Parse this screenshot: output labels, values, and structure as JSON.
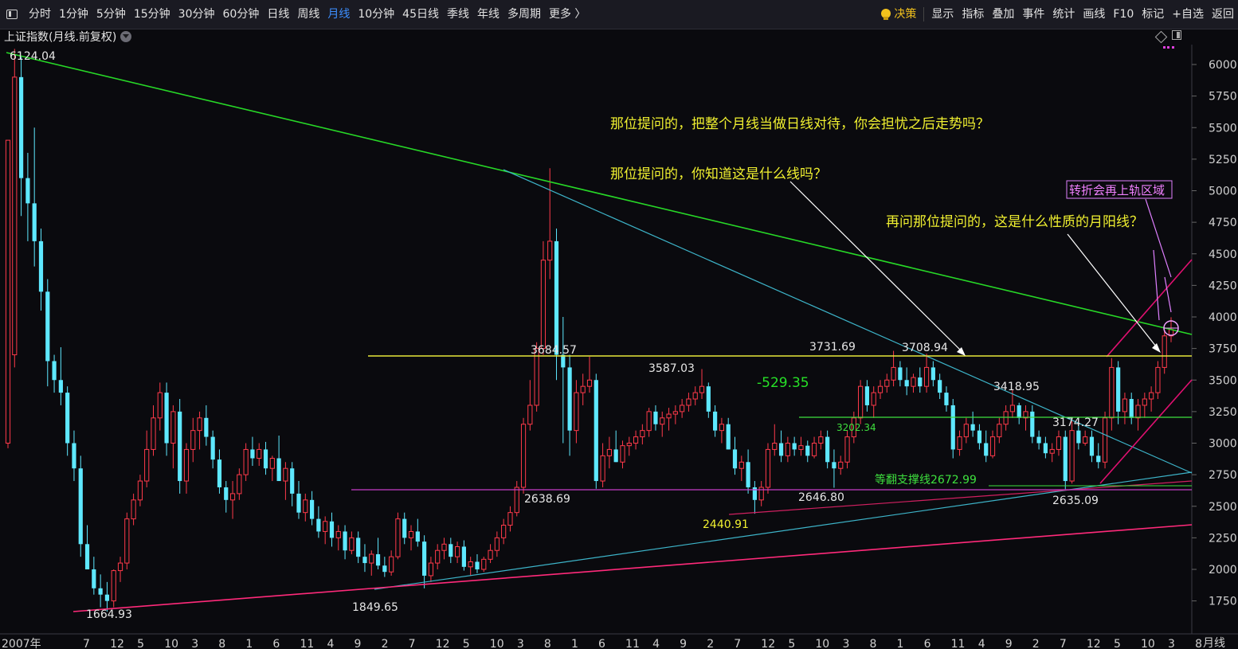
{
  "toolbar": {
    "periods": [
      "分时",
      "1分钟",
      "5分钟",
      "15分钟",
      "30分钟",
      "60分钟",
      "日线",
      "周线",
      "月线",
      "10分钟",
      "45日线",
      "季线",
      "年线",
      "多周期",
      "更多 〉"
    ],
    "active_period": "月线",
    "right_items": [
      "显示",
      "指标",
      "叠加",
      "事件",
      "统计",
      "画线",
      "F10",
      "标记",
      "+自选",
      "返回"
    ],
    "decision": "决策"
  },
  "instrument_title": "上证指数(月线.前复权)",
  "period_label": "月线",
  "colors": {
    "up": "#ff3a4a",
    "down": "#5ee8ff",
    "background": "#0a0a0e",
    "accent": "#3d8fff"
  },
  "chart_data": {
    "type": "candlestick",
    "y_ticks": [
      "6000",
      "5750",
      "5500",
      "5250",
      "5000",
      "4750",
      "4500",
      "4250",
      "4000",
      "3750",
      "3500",
      "3250",
      "3000",
      "2750",
      "2500",
      "2250",
      "2000",
      "1750"
    ],
    "x_ticks": [
      "2007年",
      "7",
      "12",
      "5",
      "10",
      "3",
      "8",
      "1",
      "6",
      "11",
      "4",
      "9",
      "2",
      "7",
      "12",
      "5",
      "10",
      "3",
      "8",
      "1",
      "6",
      "11",
      "4",
      "9",
      "2",
      "7",
      "12",
      "5",
      "10",
      "3",
      "8",
      "1",
      "6",
      "11",
      "4",
      "9",
      "2",
      "7",
      "12",
      "5",
      "10",
      "3",
      "8"
    ],
    "price_labels": [
      "6124.04",
      "1664.93",
      "1849.65",
      "3684.57",
      "2638.69",
      "3587.03",
      "2440.91",
      "2646.80",
      "3731.69",
      "3708.94",
      "3418.95",
      "3174.27",
      "2635.09",
      "3202.34"
    ],
    "annotations": {
      "q1": "那位提问的，把整个月线当做日线对待，你会担忧之后走势吗？",
      "q2": "那位提问的，你知道这是什么线吗？",
      "q3": "再问那位提问的，这是什么性质的月阳线？",
      "zone": "转折会再上轨区域",
      "diff": "-529.35",
      "support": "等翻支撑线2672.99"
    },
    "candles": [
      [
        3000,
        3700,
        2960,
        5400
      ],
      [
        3700,
        6124,
        3600,
        5900
      ],
      [
        5900,
        6060,
        4800,
        5100
      ],
      [
        5100,
        5300,
        4600,
        4900
      ],
      [
        4900,
        5500,
        4400,
        4600
      ],
      [
        4600,
        4700,
        4050,
        4200
      ],
      [
        4200,
        4300,
        3450,
        3650
      ],
      [
        3650,
        3700,
        3400,
        3500
      ],
      [
        3500,
        3760,
        3300,
        3400
      ],
      [
        3400,
        3450,
        2900,
        3000
      ],
      [
        3000,
        3100,
        2700,
        2800
      ],
      [
        2800,
        2900,
        2100,
        2200
      ],
      [
        2200,
        2350,
        2000,
        2000
      ],
      [
        2000,
        2100,
        1800,
        1850
      ],
      [
        1850,
        1960,
        1700,
        1800
      ],
      [
        1800,
        1900,
        1664.93,
        1750
      ],
      [
        1750,
        2000,
        1700,
        1990
      ],
      [
        1990,
        2100,
        1900,
        2050
      ],
      [
        2050,
        2450,
        2000,
        2400
      ],
      [
        2400,
        2600,
        2350,
        2550
      ],
      [
        2550,
        2750,
        2500,
        2700
      ],
      [
        2700,
        3100,
        2650,
        2950
      ],
      [
        2950,
        3300,
        2900,
        3200
      ],
      [
        3200,
        3480,
        3100,
        3400
      ],
      [
        3400,
        3480,
        2900,
        3000
      ],
      [
        3000,
        3300,
        2800,
        3250
      ],
      [
        3250,
        3350,
        2600,
        2700
      ],
      [
        2700,
        3000,
        2600,
        2950
      ],
      [
        2950,
        3200,
        2850,
        3100
      ],
      [
        3100,
        3250,
        2950,
        3200
      ],
      [
        3200,
        3300,
        2980,
        3050
      ],
      [
        3050,
        3100,
        2800,
        2870
      ],
      [
        2870,
        2950,
        2600,
        2650
      ],
      [
        2650,
        2700,
        2450,
        2550
      ],
      [
        2550,
        2700,
        2400,
        2600
      ],
      [
        2600,
        2800,
        2550,
        2750
      ],
      [
        2750,
        3000,
        2700,
        2950
      ],
      [
        2950,
        3050,
        2820,
        2880
      ],
      [
        2880,
        3000,
        2820,
        2950
      ],
      [
        2950,
        3010,
        2750,
        2800
      ],
      [
        2800,
        2900,
        2700,
        2880
      ],
      [
        2880,
        3060,
        2800,
        2700
      ],
      [
        2700,
        2850,
        2550,
        2800
      ],
      [
        2800,
        2850,
        2500,
        2600
      ],
      [
        2600,
        2700,
        2400,
        2450
      ],
      [
        2450,
        2600,
        2380,
        2550
      ],
      [
        2550,
        2620,
        2350,
        2400
      ],
      [
        2400,
        2500,
        2250,
        2300
      ],
      [
        2300,
        2420,
        2200,
        2380
      ],
      [
        2380,
        2450,
        2180,
        2250
      ],
      [
        2250,
        2350,
        2150,
        2300
      ],
      [
        2300,
        2350,
        2080,
        2150
      ],
      [
        2150,
        2300,
        2120,
        2250
      ],
      [
        2250,
        2300,
        2050,
        2100
      ],
      [
        2100,
        2200,
        1980,
        2050
      ],
      [
        2050,
        2150,
        1950,
        2120
      ],
      [
        2120,
        2250,
        2000,
        2030
      ],
      [
        2030,
        2100,
        1940,
        1980
      ],
      [
        1980,
        2150,
        1950,
        2100
      ],
      [
        2100,
        2450,
        2080,
        2400
      ],
      [
        2400,
        2450,
        2200,
        2250
      ],
      [
        2250,
        2350,
        2150,
        2300
      ],
      [
        2300,
        2400,
        2180,
        2220
      ],
      [
        2220,
        2270,
        1849.65,
        1950
      ],
      [
        1950,
        2100,
        1900,
        2050
      ],
      [
        2050,
        2200,
        2000,
        2150
      ],
      [
        2150,
        2250,
        2080,
        2200
      ],
      [
        2200,
        2250,
        2050,
        2100
      ],
      [
        2100,
        2220,
        2050,
        2180
      ],
      [
        2180,
        2230,
        1990,
        2020
      ],
      [
        2020,
        2100,
        1950,
        2060
      ],
      [
        2060,
        2120,
        1970,
        2000
      ],
      [
        2000,
        2100,
        1980,
        2080
      ],
      [
        2080,
        2200,
        2050,
        2150
      ],
      [
        2150,
        2300,
        2100,
        2250
      ],
      [
        2250,
        2400,
        2200,
        2350
      ],
      [
        2350,
        2500,
        2300,
        2450
      ],
      [
        2450,
        2700,
        2420,
        2650
      ],
      [
        2650,
        3200,
        2600,
        3150
      ],
      [
        3150,
        3500,
        3100,
        3300
      ],
      [
        3300,
        3800,
        3250,
        3750
      ],
      [
        3750,
        4600,
        3700,
        4450
      ],
      [
        4450,
        5178,
        4300,
        4600
      ],
      [
        4600,
        4700,
        3500,
        3700
      ],
      [
        3700,
        4000,
        3000,
        3600
      ],
      [
        3600,
        3700,
        2900,
        3100
      ],
      [
        3100,
        3500,
        3000,
        3400
      ],
      [
        3400,
        3550,
        3300,
        3450
      ],
      [
        3450,
        3684.57,
        3400,
        3500
      ],
      [
        3500,
        3550,
        2638.69,
        2700
      ],
      [
        2700,
        3000,
        2650,
        2900
      ],
      [
        2900,
        3050,
        2800,
        2950
      ],
      [
        2950,
        3100,
        2850,
        2850
      ],
      [
        2850,
        3020,
        2800,
        2980
      ],
      [
        2980,
        3050,
        2900,
        3000
      ],
      [
        3000,
        3100,
        2950,
        3050
      ],
      [
        3050,
        3150,
        2990,
        3100
      ],
      [
        3100,
        3280,
        3050,
        3250
      ],
      [
        3250,
        3300,
        3100,
        3150
      ],
      [
        3150,
        3250,
        3050,
        3200
      ],
      [
        3200,
        3280,
        3100,
        3230
      ],
      [
        3230,
        3300,
        3150,
        3250
      ],
      [
        3250,
        3350,
        3200,
        3300
      ],
      [
        3300,
        3400,
        3250,
        3350
      ],
      [
        3350,
        3450,
        3300,
        3400
      ],
      [
        3400,
        3587.03,
        3350,
        3450
      ],
      [
        3450,
        3480,
        3200,
        3250
      ],
      [
        3250,
        3300,
        3050,
        3100
      ],
      [
        3100,
        3200,
        3000,
        3150
      ],
      [
        3150,
        3200,
        2950,
        2950
      ],
      [
        2950,
        3050,
        2750,
        2800
      ],
      [
        2800,
        2900,
        2700,
        2850
      ],
      [
        2850,
        2950,
        2600,
        2650
      ],
      [
        2650,
        2700,
        2440.91,
        2550
      ],
      [
        2550,
        2700,
        2500,
        2650
      ],
      [
        2650,
        3000,
        2600,
        2950
      ],
      [
        2950,
        3150,
        2900,
        3000
      ],
      [
        3000,
        3100,
        2850,
        2900
      ],
      [
        2900,
        3050,
        2850,
        3000
      ],
      [
        3000,
        3050,
        2900,
        2950
      ],
      [
        2950,
        3050,
        2900,
        2980
      ],
      [
        2980,
        3020,
        2850,
        2900
      ],
      [
        2900,
        3050,
        2880,
        3000
      ],
      [
        3000,
        3100,
        2950,
        3050
      ],
      [
        3050,
        3100,
        2800,
        2850
      ],
      [
        2850,
        2950,
        2646.8,
        2800
      ],
      [
        2800,
        2900,
        2750,
        2850
      ],
      [
        2850,
        3100,
        2800,
        3050
      ],
      [
        3050,
        3250,
        3000,
        3200
      ],
      [
        3200,
        3500,
        3150,
        3450
      ],
      [
        3450,
        3500,
        3250,
        3300
      ],
      [
        3300,
        3450,
        3200,
        3400
      ],
      [
        3400,
        3500,
        3350,
        3450
      ],
      [
        3450,
        3550,
        3400,
        3500
      ],
      [
        3500,
        3731.69,
        3450,
        3600
      ],
      [
        3600,
        3650,
        3450,
        3500
      ],
      [
        3500,
        3600,
        3380,
        3450
      ],
      [
        3450,
        3550,
        3400,
        3520
      ],
      [
        3520,
        3600,
        3400,
        3450
      ],
      [
        3450,
        3708.94,
        3400,
        3600
      ],
      [
        3600,
        3650,
        3450,
        3500
      ],
      [
        3500,
        3550,
        3350,
        3400
      ],
      [
        3400,
        3450,
        3250,
        3300
      ],
      [
        3300,
        3350,
        2880,
        2950
      ],
      [
        2950,
        3100,
        2900,
        3050
      ],
      [
        3050,
        3200,
        3000,
        3150
      ],
      [
        3150,
        3250,
        3050,
        3100
      ],
      [
        3100,
        3150,
        2950,
        3000
      ],
      [
        3000,
        3100,
        2850,
        2900
      ],
      [
        2900,
        3100,
        2880,
        3050
      ],
      [
        3050,
        3200,
        3000,
        3150
      ],
      [
        3150,
        3300,
        3100,
        3250
      ],
      [
        3250,
        3418.95,
        3200,
        3300
      ],
      [
        3300,
        3320,
        3150,
        3200
      ],
      [
        3200,
        3300,
        3100,
        3250
      ],
      [
        3250,
        3300,
        3000,
        3050
      ],
      [
        3050,
        3100,
        2950,
        3000
      ],
      [
        3000,
        3050,
        2880,
        2920
      ],
      [
        2920,
        3000,
        2850,
        2950
      ],
      [
        2950,
        3100,
        2900,
        3050
      ],
      [
        3050,
        3100,
        2635.09,
        2700
      ],
      [
        2700,
        3174.27,
        2680,
        3100
      ],
      [
        3100,
        3150,
        2950,
        3000
      ],
      [
        3000,
        3100,
        2980,
        3050
      ],
      [
        3050,
        3100,
        2850,
        2900
      ],
      [
        2900,
        3000,
        2800,
        2850
      ],
      [
        2850,
        3250,
        2800,
        3200
      ],
      [
        3200,
        3674,
        3100,
        3600
      ],
      [
        3600,
        3650,
        3150,
        3250
      ],
      [
        3250,
        3400,
        3150,
        3350
      ],
      [
        3350,
        3400,
        3150,
        3200
      ],
      [
        3200,
        3350,
        3100,
        3300
      ],
      [
        3300,
        3400,
        3200,
        3350
      ],
      [
        3350,
        3450,
        3250,
        3400
      ],
      [
        3400,
        3650,
        3350,
        3600
      ],
      [
        3600,
        3900,
        3550,
        3850
      ],
      [
        3850,
        3998,
        3800,
        3900
      ]
    ]
  }
}
